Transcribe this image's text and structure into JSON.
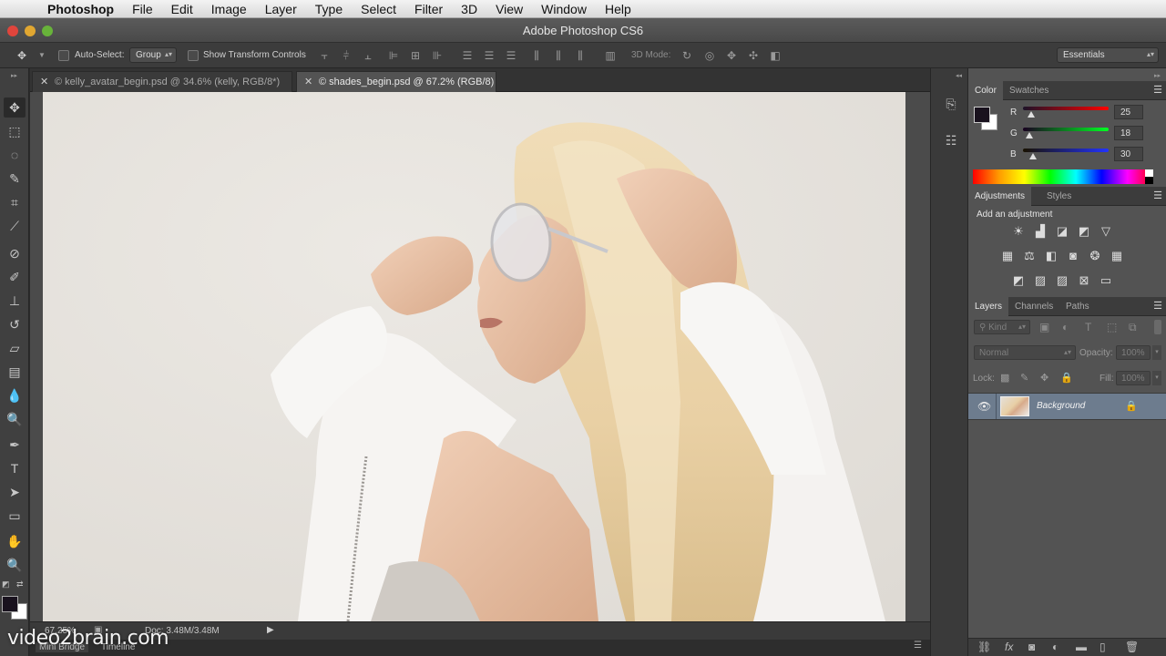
{
  "menubar": {
    "app_name": "Photoshop",
    "items": [
      "File",
      "Edit",
      "Image",
      "Layer",
      "Type",
      "Select",
      "Filter",
      "3D",
      "View",
      "Window",
      "Help"
    ]
  },
  "window": {
    "title": "Adobe Photoshop CS6"
  },
  "options": {
    "auto_select_label": "Auto-Select:",
    "auto_select_value": "Group",
    "show_transform_label": "Show Transform Controls",
    "mode_3d_label": "3D Mode:",
    "workspace_value": "Essentials"
  },
  "tabs": [
    {
      "label": "© kelly_avatar_begin.psd @ 34.6% (kelly, RGB/8*)"
    },
    {
      "label": "© shades_begin.psd @ 67.2% (RGB/8)"
    }
  ],
  "status": {
    "zoom": "67.25%",
    "doc": "Doc: 3.48M/3.48M",
    "bottom_tabs": [
      "Mini Bridge",
      "Timeline"
    ]
  },
  "color_panel": {
    "tabs": [
      "Color",
      "Swatches"
    ],
    "channels": [
      {
        "label": "R",
        "value": "25"
      },
      {
        "label": "G",
        "value": "18"
      },
      {
        "label": "B",
        "value": "30"
      }
    ],
    "foreground": "#19121e",
    "background": "#ffffff"
  },
  "adjustments_panel": {
    "tabs": [
      "Adjustments",
      "Styles"
    ],
    "heading": "Add an adjustment"
  },
  "layers_panel": {
    "tabs": [
      "Layers",
      "Channels",
      "Paths"
    ],
    "filter_kind": "Kind",
    "blend_mode": "Normal",
    "opacity_label": "Opacity:",
    "opacity_value": "100%",
    "lock_label": "Lock:",
    "fill_label": "Fill:",
    "fill_value": "100%",
    "layers": [
      {
        "name": "Background",
        "visible": true,
        "locked": true
      }
    ]
  },
  "watermark": "video2brain.com"
}
